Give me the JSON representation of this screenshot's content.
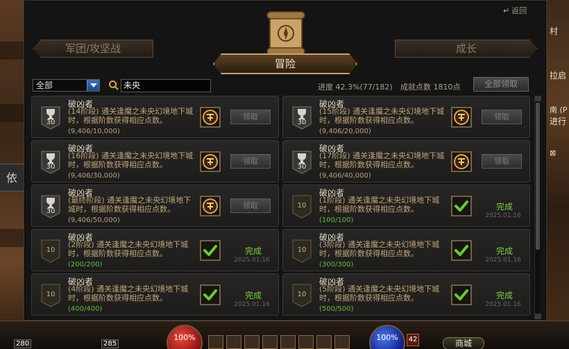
{
  "window": {
    "back_label": "返回",
    "tabs": {
      "left": "军团/攻坚战",
      "main": "冒险",
      "right": "成长"
    }
  },
  "filter": {
    "category_selected": "全部",
    "search_value": "未央",
    "progress_text": "进度 42.3%(77/182)",
    "points_text": "成就点数 1810点",
    "claim_all_label": "全部领取"
  },
  "achievements": [
    {
      "title": "破凶者",
      "desc": "(14阶段) 通关逢魔之未央幻境地下城时，根据阶数获得相应点数。",
      "progress": "(9,406/10,000)",
      "points": "30",
      "status": "pending",
      "button": "领取"
    },
    {
      "title": "破凶者",
      "desc": "(15阶段) 通关逢魔之未央幻境地下城时，根据阶数获得相应点数。",
      "progress": "(9,406/20,000)",
      "points": "30",
      "status": "pending",
      "button": "领取"
    },
    {
      "title": "破凶者",
      "desc": "(16阶段) 通关逢魔之未央幻境地下城时，根据阶数获得相应点数。",
      "progress": "(9,406/30,000)",
      "points": "30",
      "status": "pending",
      "button": "领取"
    },
    {
      "title": "破凶者",
      "desc": "(17阶段) 通关逢魔之未央幻境地下城时，根据阶数获得相应点数。",
      "progress": "(9,406/40,000)",
      "points": "30",
      "status": "pending",
      "button": "领取"
    },
    {
      "title": "破凶者",
      "desc": "(最终阶段) 通关逢魔之未央幻境地下城时，根据阶数获得相应点数。",
      "progress": "(9,406/50,000)",
      "points": "30",
      "status": "pending",
      "button": "领取"
    },
    {
      "title": "破凶者",
      "desc": "(1阶段) 通关逢魔之未央幻境地下城时，根据阶数获得相应点数。",
      "progress": "(100/100)",
      "points": "10",
      "status": "done",
      "done_label": "完成",
      "date": "2025.01.16"
    },
    {
      "title": "破凶者",
      "desc": "(2阶段) 通关逢魔之未央幻境地下城时，根据阶数获得相应点数。",
      "progress": "(200/200)",
      "points": "10",
      "status": "done",
      "done_label": "完成",
      "date": "2025.01.16"
    },
    {
      "title": "破凶者",
      "desc": "(3阶段) 通关逢魔之未央幻境地下城时，根据阶数获得相应点数。",
      "progress": "(300/300)",
      "points": "10",
      "status": "done",
      "done_label": "完成",
      "date": "2025.01.16"
    },
    {
      "title": "破凶者",
      "desc": "(4阶段) 通关逢魔之未央幻境地下城时，根据阶数获得相应点数。",
      "progress": "(400/400)",
      "points": "10",
      "status": "done",
      "done_label": "完成",
      "date": "2025.01.16"
    },
    {
      "title": "破凶者",
      "desc": "(5阶段) 通关逢魔之未央幻境地下城时，根据阶数获得相应点数。",
      "progress": "(500/500)",
      "points": "10",
      "status": "done",
      "done_label": "完成",
      "date": "2025.01.16"
    }
  ],
  "side": {
    "left_sign": "依",
    "right_texts": [
      "村",
      "拉启",
      "南 (P",
      "进行",
      "⊠"
    ]
  },
  "hud": {
    "hp_text": "100%",
    "mp_text": "100%",
    "left_num_a": "280",
    "left_num_b": "285",
    "level": "42",
    "shop_label": "商城"
  },
  "colors": {
    "accent_gold": "#c9a36a",
    "done_green": "#7fd136",
    "window_bg": "#151414"
  }
}
